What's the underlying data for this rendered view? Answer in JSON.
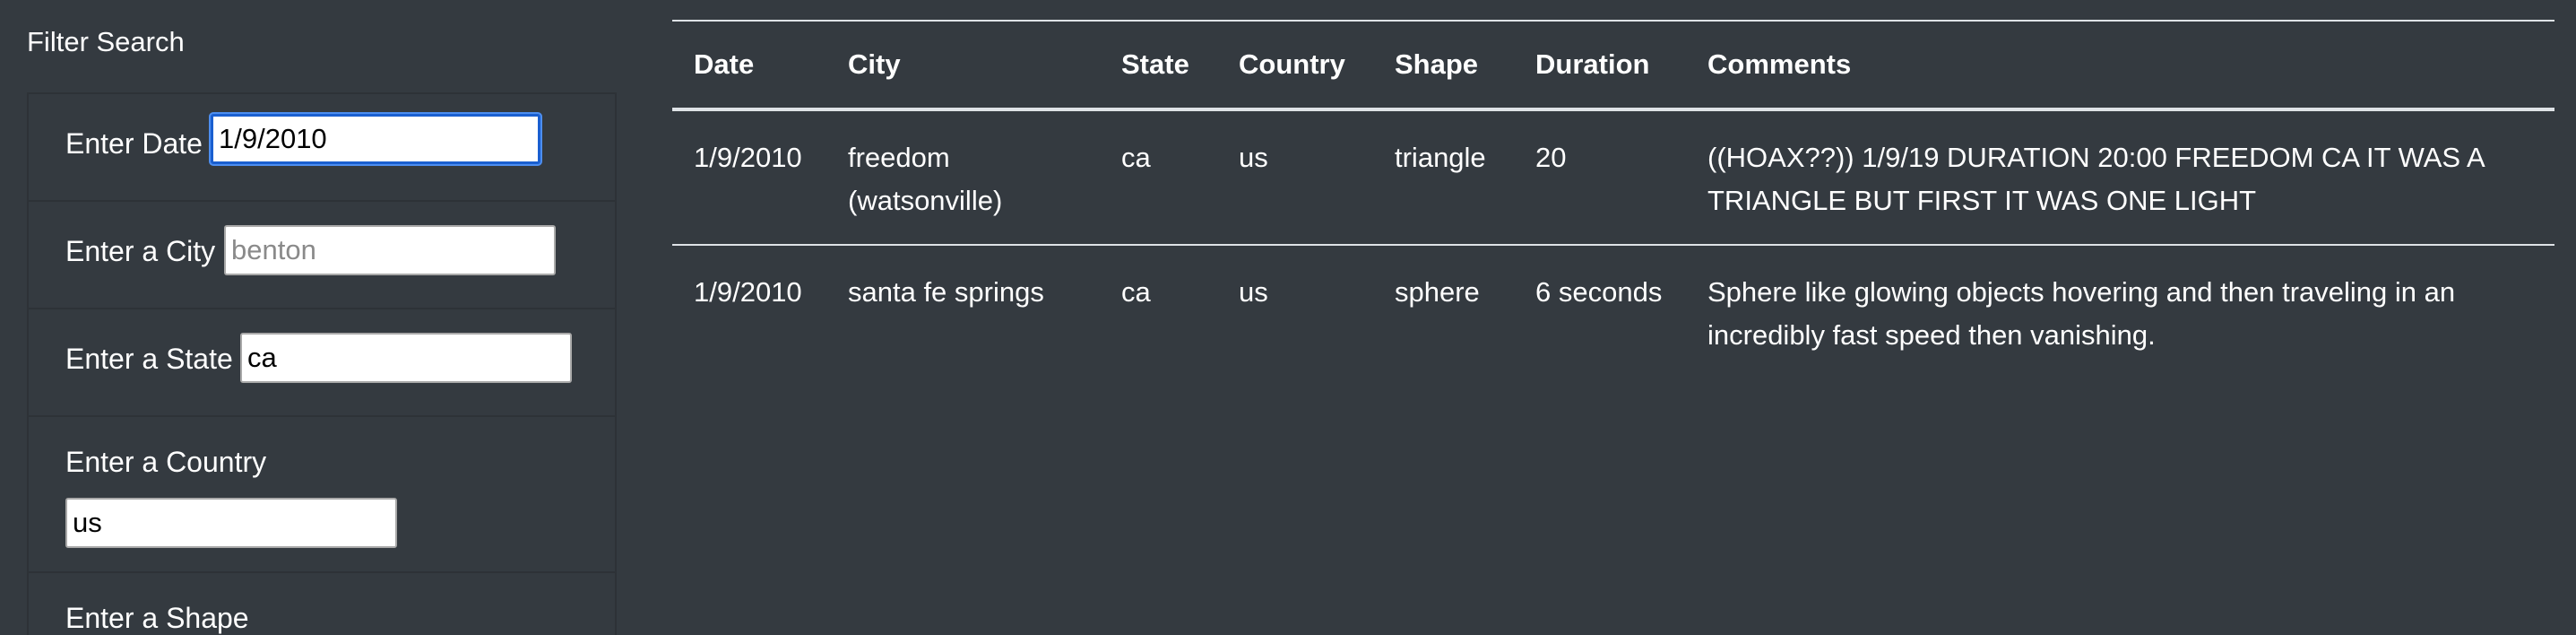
{
  "sidebar": {
    "title": "Filter Search",
    "filters": [
      {
        "label": "Enter Date",
        "value": "1/9/2010",
        "placeholder": ""
      },
      {
        "label": "Enter a City",
        "value": "",
        "placeholder": "benton"
      },
      {
        "label": "Enter a State",
        "value": "ca",
        "placeholder": ""
      },
      {
        "label": "Enter a Country",
        "value": "us",
        "placeholder": ""
      },
      {
        "label": "Enter a Shape",
        "value": "",
        "placeholder": ""
      }
    ]
  },
  "table": {
    "headers": [
      "Date",
      "City",
      "State",
      "Country",
      "Shape",
      "Duration",
      "Comments"
    ],
    "rows": [
      [
        "1/9/2010",
        "freedom (watsonville)",
        "ca",
        "us",
        "triangle",
        "20",
        "((HOAX??)) 1/9/19 DURATION 20:00 FREEDOM CA IT WAS A TRIANGLE BUT FIRST IT WAS ONE LIGHT"
      ],
      [
        "1/9/2010",
        "santa fe springs",
        "ca",
        "us",
        "sphere",
        "6 seconds",
        "Sphere like glowing objects hovering and then traveling in an incredibly fast speed then vanishing."
      ]
    ]
  }
}
